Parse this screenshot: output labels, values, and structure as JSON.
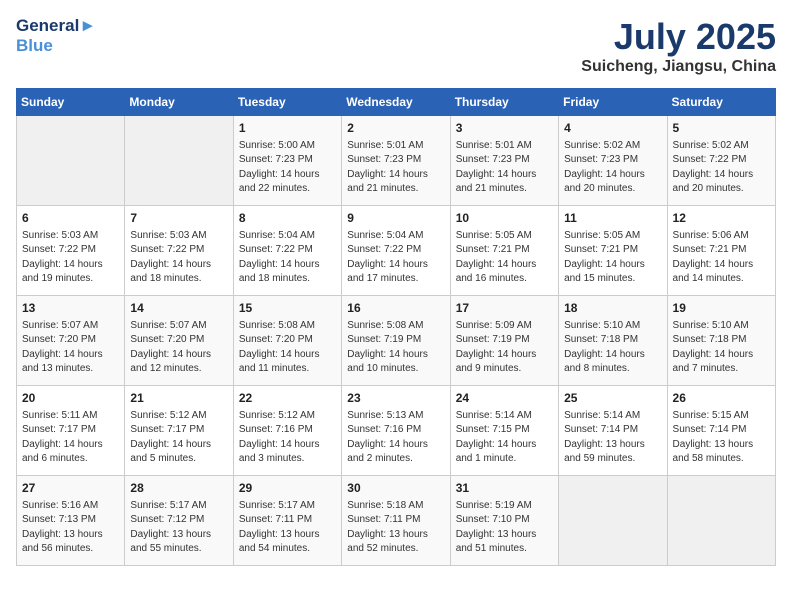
{
  "header": {
    "logo_line1": "General",
    "logo_line2": "Blue",
    "month_year": "July 2025",
    "location": "Suicheng, Jiangsu, China"
  },
  "weekdays": [
    "Sunday",
    "Monday",
    "Tuesday",
    "Wednesday",
    "Thursday",
    "Friday",
    "Saturday"
  ],
  "weeks": [
    [
      {
        "day": null,
        "sunrise": null,
        "sunset": null,
        "daylight": null
      },
      {
        "day": null,
        "sunrise": null,
        "sunset": null,
        "daylight": null
      },
      {
        "day": "1",
        "sunrise": "5:00 AM",
        "sunset": "7:23 PM",
        "daylight": "14 hours and 22 minutes."
      },
      {
        "day": "2",
        "sunrise": "5:01 AM",
        "sunset": "7:23 PM",
        "daylight": "14 hours and 21 minutes."
      },
      {
        "day": "3",
        "sunrise": "5:01 AM",
        "sunset": "7:23 PM",
        "daylight": "14 hours and 21 minutes."
      },
      {
        "day": "4",
        "sunrise": "5:02 AM",
        "sunset": "7:23 PM",
        "daylight": "14 hours and 20 minutes."
      },
      {
        "day": "5",
        "sunrise": "5:02 AM",
        "sunset": "7:22 PM",
        "daylight": "14 hours and 20 minutes."
      }
    ],
    [
      {
        "day": "6",
        "sunrise": "5:03 AM",
        "sunset": "7:22 PM",
        "daylight": "14 hours and 19 minutes."
      },
      {
        "day": "7",
        "sunrise": "5:03 AM",
        "sunset": "7:22 PM",
        "daylight": "14 hours and 18 minutes."
      },
      {
        "day": "8",
        "sunrise": "5:04 AM",
        "sunset": "7:22 PM",
        "daylight": "14 hours and 18 minutes."
      },
      {
        "day": "9",
        "sunrise": "5:04 AM",
        "sunset": "7:22 PM",
        "daylight": "14 hours and 17 minutes."
      },
      {
        "day": "10",
        "sunrise": "5:05 AM",
        "sunset": "7:21 PM",
        "daylight": "14 hours and 16 minutes."
      },
      {
        "day": "11",
        "sunrise": "5:05 AM",
        "sunset": "7:21 PM",
        "daylight": "14 hours and 15 minutes."
      },
      {
        "day": "12",
        "sunrise": "5:06 AM",
        "sunset": "7:21 PM",
        "daylight": "14 hours and 14 minutes."
      }
    ],
    [
      {
        "day": "13",
        "sunrise": "5:07 AM",
        "sunset": "7:20 PM",
        "daylight": "14 hours and 13 minutes."
      },
      {
        "day": "14",
        "sunrise": "5:07 AM",
        "sunset": "7:20 PM",
        "daylight": "14 hours and 12 minutes."
      },
      {
        "day": "15",
        "sunrise": "5:08 AM",
        "sunset": "7:20 PM",
        "daylight": "14 hours and 11 minutes."
      },
      {
        "day": "16",
        "sunrise": "5:08 AM",
        "sunset": "7:19 PM",
        "daylight": "14 hours and 10 minutes."
      },
      {
        "day": "17",
        "sunrise": "5:09 AM",
        "sunset": "7:19 PM",
        "daylight": "14 hours and 9 minutes."
      },
      {
        "day": "18",
        "sunrise": "5:10 AM",
        "sunset": "7:18 PM",
        "daylight": "14 hours and 8 minutes."
      },
      {
        "day": "19",
        "sunrise": "5:10 AM",
        "sunset": "7:18 PM",
        "daylight": "14 hours and 7 minutes."
      }
    ],
    [
      {
        "day": "20",
        "sunrise": "5:11 AM",
        "sunset": "7:17 PM",
        "daylight": "14 hours and 6 minutes."
      },
      {
        "day": "21",
        "sunrise": "5:12 AM",
        "sunset": "7:17 PM",
        "daylight": "14 hours and 5 minutes."
      },
      {
        "day": "22",
        "sunrise": "5:12 AM",
        "sunset": "7:16 PM",
        "daylight": "14 hours and 3 minutes."
      },
      {
        "day": "23",
        "sunrise": "5:13 AM",
        "sunset": "7:16 PM",
        "daylight": "14 hours and 2 minutes."
      },
      {
        "day": "24",
        "sunrise": "5:14 AM",
        "sunset": "7:15 PM",
        "daylight": "14 hours and 1 minute."
      },
      {
        "day": "25",
        "sunrise": "5:14 AM",
        "sunset": "7:14 PM",
        "daylight": "13 hours and 59 minutes."
      },
      {
        "day": "26",
        "sunrise": "5:15 AM",
        "sunset": "7:14 PM",
        "daylight": "13 hours and 58 minutes."
      }
    ],
    [
      {
        "day": "27",
        "sunrise": "5:16 AM",
        "sunset": "7:13 PM",
        "daylight": "13 hours and 56 minutes."
      },
      {
        "day": "28",
        "sunrise": "5:17 AM",
        "sunset": "7:12 PM",
        "daylight": "13 hours and 55 minutes."
      },
      {
        "day": "29",
        "sunrise": "5:17 AM",
        "sunset": "7:11 PM",
        "daylight": "13 hours and 54 minutes."
      },
      {
        "day": "30",
        "sunrise": "5:18 AM",
        "sunset": "7:11 PM",
        "daylight": "13 hours and 52 minutes."
      },
      {
        "day": "31",
        "sunrise": "5:19 AM",
        "sunset": "7:10 PM",
        "daylight": "13 hours and 51 minutes."
      },
      {
        "day": null,
        "sunrise": null,
        "sunset": null,
        "daylight": null
      },
      {
        "day": null,
        "sunrise": null,
        "sunset": null,
        "daylight": null
      }
    ]
  ]
}
